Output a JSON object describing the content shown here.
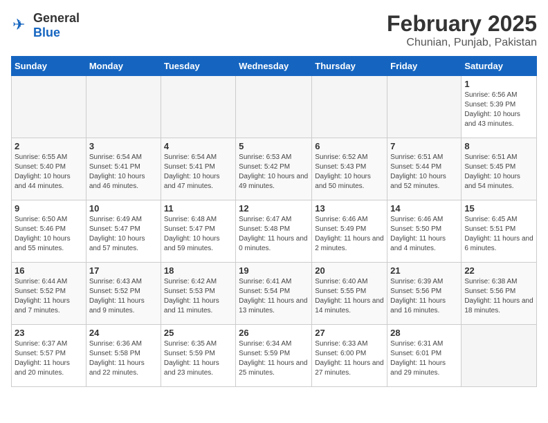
{
  "header": {
    "logo": {
      "text1": "General",
      "text2": "Blue"
    },
    "title": "February 2025",
    "location": "Chunian, Punjab, Pakistan"
  },
  "days_of_week": [
    "Sunday",
    "Monday",
    "Tuesday",
    "Wednesday",
    "Thursday",
    "Friday",
    "Saturday"
  ],
  "weeks": [
    [
      {
        "day": "",
        "info": ""
      },
      {
        "day": "",
        "info": ""
      },
      {
        "day": "",
        "info": ""
      },
      {
        "day": "",
        "info": ""
      },
      {
        "day": "",
        "info": ""
      },
      {
        "day": "",
        "info": ""
      },
      {
        "day": "1",
        "info": "Sunrise: 6:56 AM\nSunset: 5:39 PM\nDaylight: 10 hours and 43 minutes."
      }
    ],
    [
      {
        "day": "2",
        "info": "Sunrise: 6:55 AM\nSunset: 5:40 PM\nDaylight: 10 hours and 44 minutes."
      },
      {
        "day": "3",
        "info": "Sunrise: 6:54 AM\nSunset: 5:41 PM\nDaylight: 10 hours and 46 minutes."
      },
      {
        "day": "4",
        "info": "Sunrise: 6:54 AM\nSunset: 5:41 PM\nDaylight: 10 hours and 47 minutes."
      },
      {
        "day": "5",
        "info": "Sunrise: 6:53 AM\nSunset: 5:42 PM\nDaylight: 10 hours and 49 minutes."
      },
      {
        "day": "6",
        "info": "Sunrise: 6:52 AM\nSunset: 5:43 PM\nDaylight: 10 hours and 50 minutes."
      },
      {
        "day": "7",
        "info": "Sunrise: 6:51 AM\nSunset: 5:44 PM\nDaylight: 10 hours and 52 minutes."
      },
      {
        "day": "8",
        "info": "Sunrise: 6:51 AM\nSunset: 5:45 PM\nDaylight: 10 hours and 54 minutes."
      }
    ],
    [
      {
        "day": "9",
        "info": "Sunrise: 6:50 AM\nSunset: 5:46 PM\nDaylight: 10 hours and 55 minutes."
      },
      {
        "day": "10",
        "info": "Sunrise: 6:49 AM\nSunset: 5:47 PM\nDaylight: 10 hours and 57 minutes."
      },
      {
        "day": "11",
        "info": "Sunrise: 6:48 AM\nSunset: 5:47 PM\nDaylight: 10 hours and 59 minutes."
      },
      {
        "day": "12",
        "info": "Sunrise: 6:47 AM\nSunset: 5:48 PM\nDaylight: 11 hours and 0 minutes."
      },
      {
        "day": "13",
        "info": "Sunrise: 6:46 AM\nSunset: 5:49 PM\nDaylight: 11 hours and 2 minutes."
      },
      {
        "day": "14",
        "info": "Sunrise: 6:46 AM\nSunset: 5:50 PM\nDaylight: 11 hours and 4 minutes."
      },
      {
        "day": "15",
        "info": "Sunrise: 6:45 AM\nSunset: 5:51 PM\nDaylight: 11 hours and 6 minutes."
      }
    ],
    [
      {
        "day": "16",
        "info": "Sunrise: 6:44 AM\nSunset: 5:52 PM\nDaylight: 11 hours and 7 minutes."
      },
      {
        "day": "17",
        "info": "Sunrise: 6:43 AM\nSunset: 5:52 PM\nDaylight: 11 hours and 9 minutes."
      },
      {
        "day": "18",
        "info": "Sunrise: 6:42 AM\nSunset: 5:53 PM\nDaylight: 11 hours and 11 minutes."
      },
      {
        "day": "19",
        "info": "Sunrise: 6:41 AM\nSunset: 5:54 PM\nDaylight: 11 hours and 13 minutes."
      },
      {
        "day": "20",
        "info": "Sunrise: 6:40 AM\nSunset: 5:55 PM\nDaylight: 11 hours and 14 minutes."
      },
      {
        "day": "21",
        "info": "Sunrise: 6:39 AM\nSunset: 5:56 PM\nDaylight: 11 hours and 16 minutes."
      },
      {
        "day": "22",
        "info": "Sunrise: 6:38 AM\nSunset: 5:56 PM\nDaylight: 11 hours and 18 minutes."
      }
    ],
    [
      {
        "day": "23",
        "info": "Sunrise: 6:37 AM\nSunset: 5:57 PM\nDaylight: 11 hours and 20 minutes."
      },
      {
        "day": "24",
        "info": "Sunrise: 6:36 AM\nSunset: 5:58 PM\nDaylight: 11 hours and 22 minutes."
      },
      {
        "day": "25",
        "info": "Sunrise: 6:35 AM\nSunset: 5:59 PM\nDaylight: 11 hours and 23 minutes."
      },
      {
        "day": "26",
        "info": "Sunrise: 6:34 AM\nSunset: 5:59 PM\nDaylight: 11 hours and 25 minutes."
      },
      {
        "day": "27",
        "info": "Sunrise: 6:33 AM\nSunset: 6:00 PM\nDaylight: 11 hours and 27 minutes."
      },
      {
        "day": "28",
        "info": "Sunrise: 6:31 AM\nSunset: 6:01 PM\nDaylight: 11 hours and 29 minutes."
      },
      {
        "day": "",
        "info": ""
      }
    ]
  ]
}
